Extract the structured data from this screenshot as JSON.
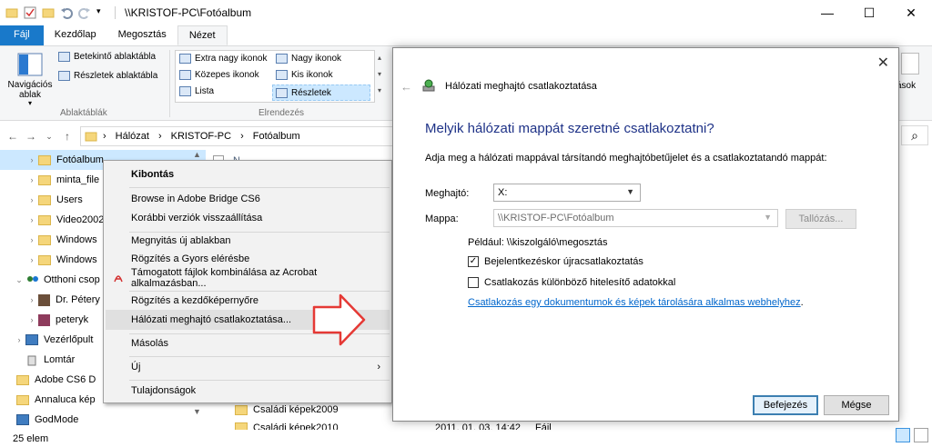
{
  "titlebar": {
    "path": "\\\\KRISTOF-PC\\Fotóalbum",
    "minimize": "—",
    "maximize": "☐",
    "close": "✕"
  },
  "ribbon": {
    "tabs": [
      "Fájl",
      "Kezdőlap",
      "Megosztás",
      "Nézet"
    ],
    "nav_pane_label": "Navigációs ablak",
    "nav_pane_arrow": "▾",
    "preview_pane": "Betekintő ablaktábla",
    "details_pane": "Részletek ablaktábla",
    "panes_group": "Ablaktáblák",
    "layout_group": "Elrendezés",
    "layout": {
      "extra_large": "Extra nagy ikonok",
      "large": "Nagy ikonok",
      "medium": "Közepes ikonok",
      "small": "Kis ikonok",
      "list": "Lista",
      "details": "Részletek"
    }
  },
  "address": {
    "back": "←",
    "forward": "→",
    "recent": "⌄",
    "up": "↑",
    "crumbs": [
      "Hálózat",
      "KRISTOF-PC",
      "Fotóalbum"
    ],
    "separator": "›",
    "search_icon": "⌕"
  },
  "navpane": {
    "items": [
      {
        "label": "Fotóalbum",
        "chev": "›"
      },
      {
        "label": "minta_file",
        "chev": "›"
      },
      {
        "label": "Users",
        "chev": "›"
      },
      {
        "label": "Video2002",
        "chev": "›"
      },
      {
        "label": "Windows",
        "chev": "›"
      },
      {
        "label": "Windows",
        "chev": "›"
      },
      {
        "label": "Otthoni csop",
        "chev": "⌄"
      },
      {
        "label": "Dr. Pétery K",
        "chev": "›"
      },
      {
        "label": "peteryk",
        "chev": "›"
      },
      {
        "label": "Vezérlőpult",
        "chev": "›"
      },
      {
        "label": "Lomtár",
        "chev": ""
      },
      {
        "label": "Adobe CS6 D",
        "chev": ""
      },
      {
        "label": "Annaluca kép",
        "chev": ""
      },
      {
        "label": "GodMode",
        "chev": ""
      }
    ]
  },
  "filelist": {
    "header_partial": "N",
    "row1": "Családi képek2009",
    "row2_partial": "Családi képek2010",
    "row2_date_partial": "2011. 01. 03. 14:42",
    "row2_type_partial": "Fájl"
  },
  "status": {
    "count": "25 elem"
  },
  "context_menu": {
    "items": [
      {
        "label": "Kibontás",
        "bold": true
      },
      {
        "label": "Browse in Adobe Bridge CS6"
      },
      {
        "label": "Korábbi verziók visszaállítása"
      },
      {
        "label": "Megnyitás új ablakban"
      },
      {
        "label": "Rögzítés a Gyors elérésbe"
      },
      {
        "label": "Támogatott fájlok kombinálása az Acrobat alkalmazásban..."
      },
      {
        "label": "Rögzítés a kezdőképernyőre"
      },
      {
        "label": "Hálózati meghajtó csatlakoztatása..."
      },
      {
        "label": "Másolás"
      },
      {
        "label": "Új",
        "arrow": "›"
      },
      {
        "label": "Tulajdonságok"
      }
    ]
  },
  "dialog": {
    "close": "✕",
    "back": "←",
    "title": "Hálózati meghajtó csatlakoztatása",
    "heading": "Melyik hálózati mappát szeretné csatlakoztatni?",
    "description": "Adja meg a hálózati mappával társítandó meghajtóbetűjelet és a csatlakoztatandó mappát:",
    "drive_label": "Meghajtó:",
    "drive_value": "X:",
    "folder_label": "Mappa:",
    "folder_value": "\\\\KRISTOF-PC\\Fotóalbum",
    "browse": "Tallózás...",
    "example": "Például: \\\\kiszolgáló\\megosztás",
    "reconnect": "Bejelentkezéskor újracsatlakoztatás",
    "reconnect_checked": "✓",
    "other_credentials": "Csatlakozás különböző hitelesítő adatokkal",
    "link": "Csatlakozás egy dokumentumok és képek tárolására alkalmas webhelyhez",
    "link_suffix": ".",
    "finish": "Befejezés",
    "cancel": "Mégse"
  },
  "right_edge": {
    "partial_text": "ások"
  },
  "colors": {
    "file_tab": "#1979ca",
    "selection": "#cce8ff",
    "heading": "#1e3287",
    "link": "#0066cc",
    "arrow": "#e53935"
  }
}
